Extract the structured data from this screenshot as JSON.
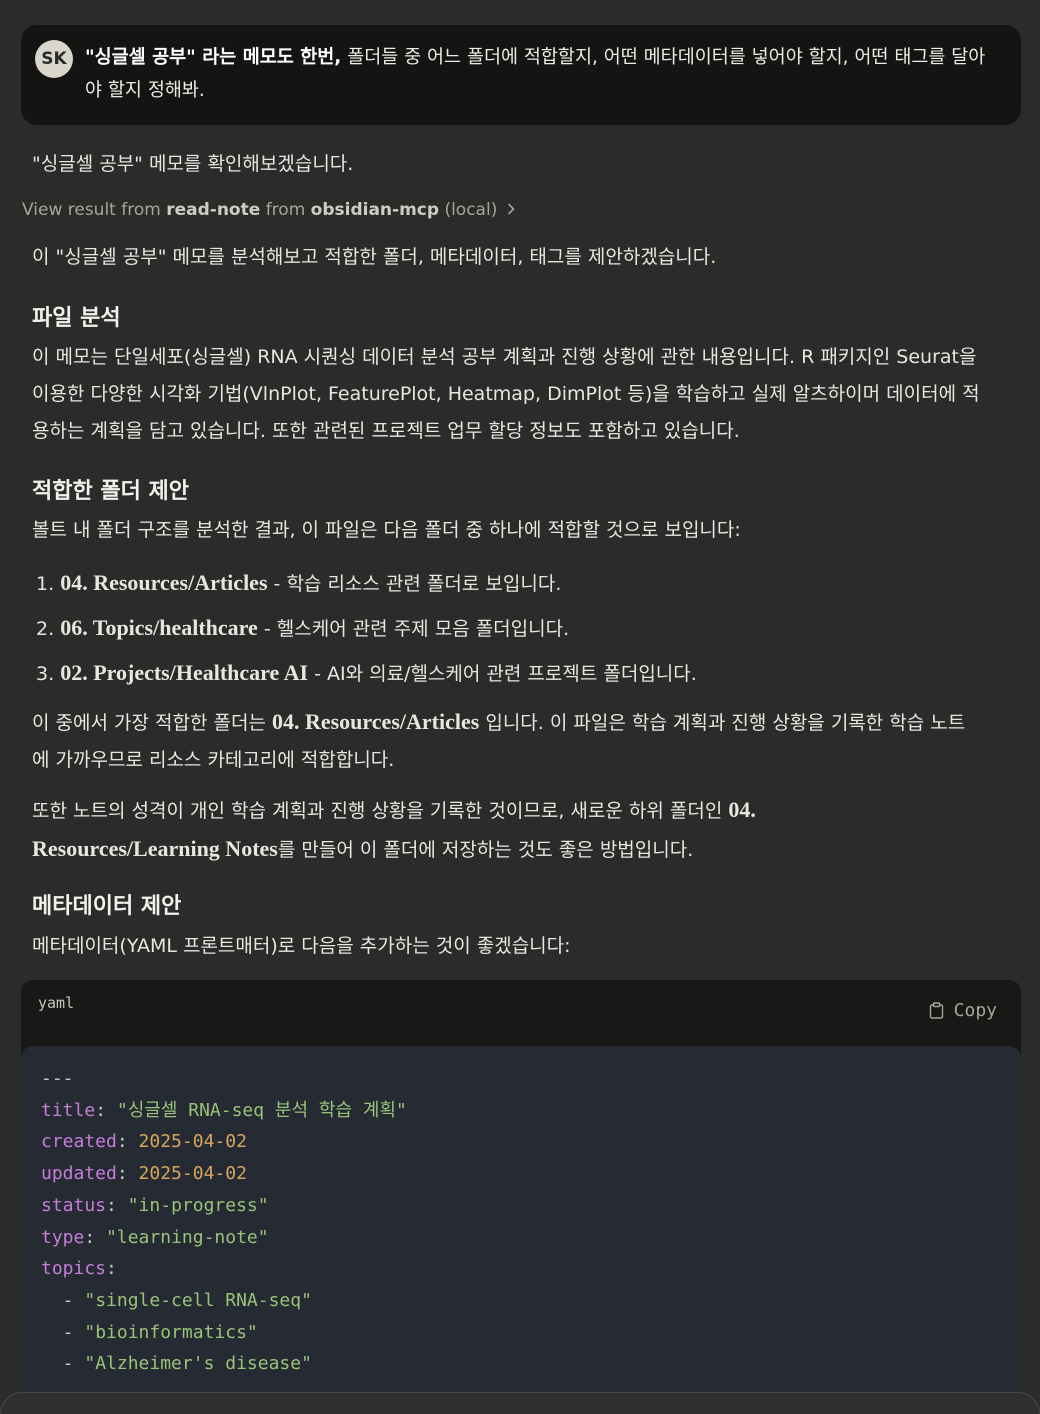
{
  "user_message": {
    "avatar_initials": "SK",
    "bold_part": "\"싱글셀 공부\" 라는 메모도 한번,",
    "rest": " 폴더들 중 어느 폴더에 적합할지, 어떤 메타데이터를 넣어야 할지, 어떤 태그를 달아야 할지 정해봐."
  },
  "intro": "\"싱글셀 공부\" 메모를 확인해보겠습니다.",
  "tool_result": {
    "prefix": "View result from ",
    "tool": "read-note",
    "middle": " from ",
    "server": "obsidian-mcp",
    "suffix": " (local)"
  },
  "summary_line": "이 \"싱글셀 공부\" 메모를 분석해보고 적합한 폴더, 메타데이터, 태그를 제안하겠습니다.",
  "sections": {
    "file_analysis": {
      "heading": "파일 분석",
      "body": "이 메모는 단일세포(싱글셀) RNA 시퀀싱 데이터 분석 공부 계획과 진행 상황에 관한 내용입니다. R 패키지인 Seurat을 이용한 다양한 시각화 기법(VlnPlot, FeaturePlot, Heatmap, DimPlot 등)을 학습하고 실제 알츠하이머 데이터에 적용하는 계획을 담고 있습니다. 또한 관련된 프로젝트 업무 할당 정보도 포함하고 있습니다."
    },
    "folder": {
      "heading": "적합한 폴더 제안",
      "intro": "볼트 내 폴더 구조를 분석한 결과, 이 파일은 다음 폴더 중 하나에 적합할 것으로 보입니다:",
      "items": [
        {
          "num": "1.",
          "name": "04. Resources/Articles",
          "desc": " - 학습 리소스 관련 폴더로 보입니다."
        },
        {
          "num": "2.",
          "name": "06. Topics/healthcare",
          "desc": " - 헬스케어 관련 주제 모음 폴더입니다."
        },
        {
          "num": "3.",
          "name": "02. Projects/Healthcare AI",
          "desc": " - AI와 의료/헬스케어 관련 프로젝트 폴더입니다."
        }
      ],
      "best_pre": "이 중에서 가장 적합한 폴더는 ",
      "best_name": "04. Resources/Articles",
      "best_post": " 입니다. 이 파일은 학습 계획과 진행 상황을 기록한 학습 노트에 가까우므로 리소스 카테고리에 적합합니다.",
      "alt_pre": "또한 노트의 성격이 개인 학습 계획과 진행 상황을 기록한 것이므로, 새로운 하위 폴더인 ",
      "alt_name": "04. Resources/Learning Notes",
      "alt_post": "를 만들어 이 폴더에 저장하는 것도 좋은 방법입니다."
    },
    "metadata": {
      "heading": "메타데이터 제안",
      "intro": "메타데이터(YAML 프론트매터)로 다음을 추가하는 것이 좋겠습니다:"
    }
  },
  "code_block": {
    "language": "yaml",
    "copy_label": "Copy",
    "lines": {
      "sep": "---",
      "title_key": "title",
      "title_val": "\"싱글셀 RNA-seq 분석 학습 계획\"",
      "created_key": "created",
      "created_val": "2025-04-02",
      "updated_key": "updated",
      "updated_val": "2025-04-02",
      "status_key": "status",
      "status_val": "\"in-progress\"",
      "type_key": "type",
      "type_val": "\"learning-note\"",
      "topics_key": "topics",
      "topic_1": "\"single-cell RNA-seq\"",
      "topic_2": "\"bioinformatics\"",
      "topic_3": "\"Alzheimer's disease\""
    }
  },
  "colors": {
    "background": "#2b2b2a",
    "user_bubble": "#141413",
    "code_header": "#181817",
    "code_body": "#262a33",
    "yaml_key": "#c57ed8",
    "yaml_string": "#98c379",
    "yaml_number": "#d6a65b"
  }
}
